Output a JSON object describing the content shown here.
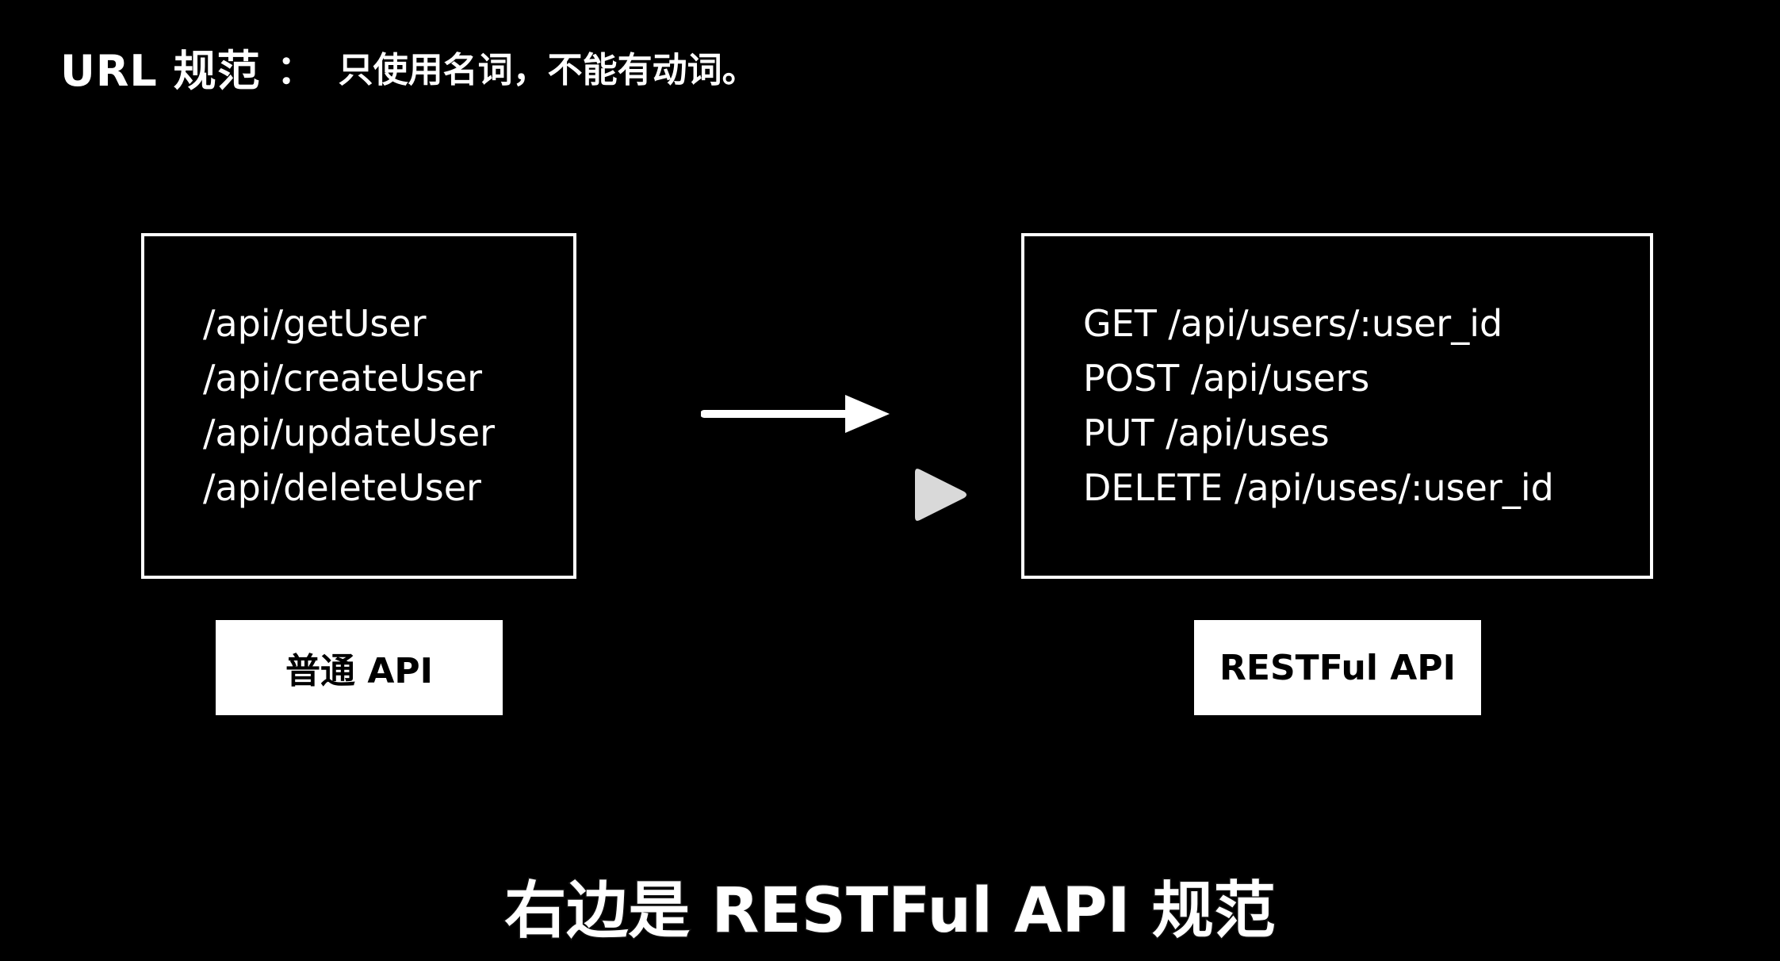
{
  "heading": {
    "main": "URL 规范",
    "colon": "：",
    "sub": "只使用名词，不能有动词。"
  },
  "left_panel": {
    "lines": [
      "/api/getUser",
      "/api/createUser",
      "/api/updateUser",
      "/api/deleteUser"
    ],
    "caption": "普通 API"
  },
  "right_panel": {
    "lines": [
      "GET /api/users/:user_id",
      "POST /api/users",
      "PUT /api/uses",
      "DELETE /api/uses/:user_id"
    ],
    "caption": "RESTFul API"
  },
  "subtitle": "右边是 RESTFul API 规范",
  "icons": {
    "arrow": "arrow-right-icon",
    "play": "play-icon"
  },
  "colors": {
    "background": "#000000",
    "foreground": "#ffffff",
    "play_button": "#d9d9d9"
  }
}
